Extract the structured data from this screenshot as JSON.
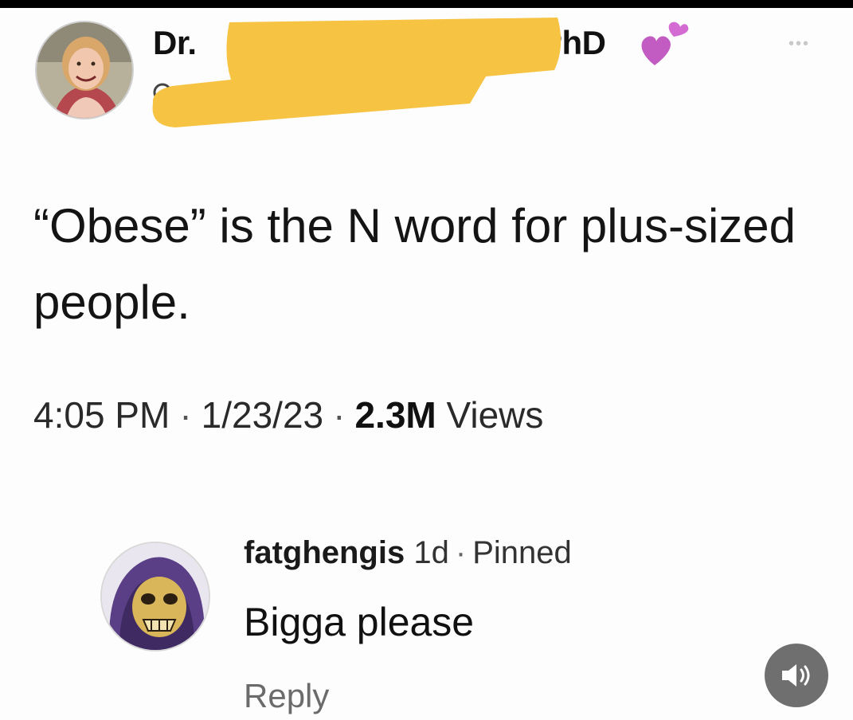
{
  "tweet": {
    "name_prefix": "Dr.",
    "name_suffix": "PhD",
    "text": "“Obese” is the N word for plus-sized people.",
    "time": "4:05 PM",
    "date": "1/23/23",
    "views_count": "2.3M",
    "views_label": "Views",
    "more_icon": "more-icon",
    "verified_icon": "heart-icon"
  },
  "comment": {
    "username": "fatghengis",
    "age": "1d",
    "pinned": "Pinned",
    "text": "Bigga please",
    "reply_label": "Reply"
  },
  "sound_icon": "speaker-icon",
  "colors": {
    "redaction": "#f6c343",
    "heart": "#c25bc2",
    "sound_button": "#6f6f6f",
    "skeletor_hood": "#5a3f86",
    "skeletor_face": "#d9b65a"
  }
}
